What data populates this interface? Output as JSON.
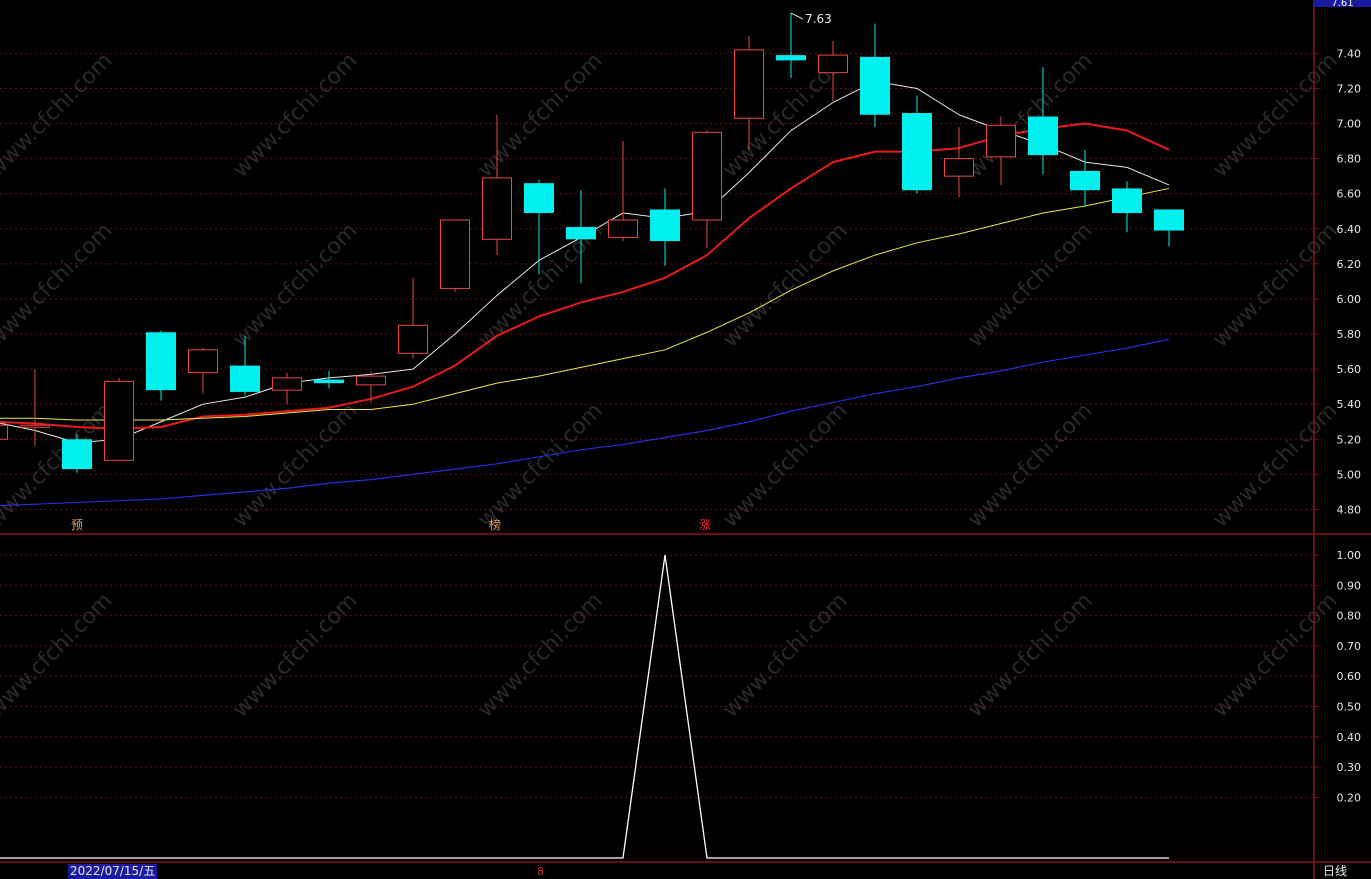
{
  "chart_data": {
    "type": "candlestick",
    "candles": [
      {
        "o": 5.2,
        "c": 5.28,
        "h": 5.34,
        "l": 5.14
      },
      {
        "o": 5.27,
        "c": 5.28,
        "h": 5.6,
        "l": 5.16
      },
      {
        "o": 5.2,
        "c": 5.03,
        "h": 5.23,
        "l": 5.01
      },
      {
        "o": 5.08,
        "c": 5.53,
        "h": 5.55,
        "l": 5.08
      },
      {
        "o": 5.81,
        "c": 5.48,
        "h": 5.82,
        "l": 5.42
      },
      {
        "o": 5.58,
        "c": 5.71,
        "h": 5.72,
        "l": 5.46
      },
      {
        "o": 5.62,
        "c": 5.47,
        "h": 5.79,
        "l": 5.45
      },
      {
        "o": 5.48,
        "c": 5.55,
        "h": 5.58,
        "l": 5.4
      },
      {
        "o": 5.54,
        "c": 5.52,
        "h": 5.59,
        "l": 5.49
      },
      {
        "o": 5.51,
        "c": 5.56,
        "h": 5.59,
        "l": 5.41
      },
      {
        "o": 5.69,
        "c": 5.85,
        "h": 6.12,
        "l": 5.66
      },
      {
        "o": 6.06,
        "c": 6.45,
        "h": 6.45,
        "l": 6.04
      },
      {
        "o": 6.34,
        "c": 6.69,
        "h": 7.05,
        "l": 6.25
      },
      {
        "o": 6.66,
        "c": 6.49,
        "h": 6.68,
        "l": 6.14
      },
      {
        "o": 6.41,
        "c": 6.34,
        "h": 6.62,
        "l": 6.09
      },
      {
        "o": 6.35,
        "c": 6.45,
        "h": 6.9,
        "l": 6.33
      },
      {
        "o": 6.51,
        "c": 6.33,
        "h": 6.63,
        "l": 6.19
      },
      {
        "o": 6.45,
        "c": 6.95,
        "h": 6.96,
        "l": 6.29
      },
      {
        "o": 7.03,
        "c": 7.42,
        "h": 7.5,
        "l": 6.85
      },
      {
        "o": 7.39,
        "c": 7.36,
        "h": 7.63,
        "l": 7.26
      },
      {
        "o": 7.29,
        "c": 7.39,
        "h": 7.47,
        "l": 7.13
      },
      {
        "o": 7.38,
        "c": 7.05,
        "h": 7.57,
        "l": 6.98
      },
      {
        "o": 7.06,
        "c": 6.62,
        "h": 7.16,
        "l": 6.6
      },
      {
        "o": 6.7,
        "c": 6.8,
        "h": 6.98,
        "l": 6.58
      },
      {
        "o": 6.81,
        "c": 6.99,
        "h": 7.04,
        "l": 6.65
      },
      {
        "o": 7.04,
        "c": 6.82,
        "h": 7.32,
        "l": 6.71
      },
      {
        "o": 6.73,
        "c": 6.62,
        "h": 6.85,
        "l": 6.53
      },
      {
        "o": 6.63,
        "c": 6.49,
        "h": 6.67,
        "l": 6.38
      },
      {
        "o": 6.51,
        "c": 6.39,
        "h": 6.51,
        "l": 6.3
      }
    ],
    "ma_lines": [
      {
        "color": "#e8e8e8",
        "width": 1,
        "values": [
          5.3,
          5.25,
          5.18,
          5.2,
          5.3,
          5.4,
          5.44,
          5.52,
          5.55,
          5.57,
          5.6,
          5.8,
          6.02,
          6.22,
          6.35,
          6.49,
          6.46,
          6.5,
          6.72,
          6.96,
          7.12,
          7.24,
          7.2,
          7.05,
          6.96,
          6.88,
          6.78,
          6.75,
          6.65
        ]
      },
      {
        "color": "#e81a1a",
        "width": 2,
        "values": [
          5.3,
          5.29,
          5.27,
          5.26,
          5.27,
          5.33,
          5.34,
          5.36,
          5.38,
          5.43,
          5.5,
          5.62,
          5.79,
          5.9,
          5.98,
          6.04,
          6.12,
          6.25,
          6.46,
          6.63,
          6.78,
          6.84,
          6.84,
          6.86,
          6.93,
          6.97,
          7.0,
          6.96,
          6.85
        ]
      },
      {
        "color": "#e8e84a",
        "width": 1,
        "values": [
          5.32,
          5.32,
          5.31,
          5.31,
          5.31,
          5.32,
          5.33,
          5.35,
          5.37,
          5.37,
          5.4,
          5.46,
          5.52,
          5.56,
          5.61,
          5.66,
          5.71,
          5.81,
          5.92,
          6.05,
          6.16,
          6.25,
          6.32,
          6.37,
          6.43,
          6.49,
          6.53,
          6.58,
          6.63
        ]
      },
      {
        "color": "#2b2bdc",
        "width": 1.2,
        "values": [
          4.82,
          4.83,
          4.84,
          4.85,
          4.86,
          4.88,
          4.9,
          4.92,
          4.95,
          4.97,
          5.0,
          5.03,
          5.06,
          5.1,
          5.14,
          5.17,
          5.21,
          5.25,
          5.3,
          5.36,
          5.41,
          5.46,
          5.5,
          5.55,
          5.59,
          5.64,
          5.68,
          5.72,
          5.77
        ]
      }
    ],
    "y_ticks": [
      "7.40",
      "7.20",
      "7.00",
      "6.80",
      "6.60",
      "6.40",
      "6.20",
      "6.00",
      "5.80",
      "5.60",
      "5.40",
      "5.20",
      "5.00",
      "4.80"
    ],
    "y_ticks_values": [
      7.4,
      7.2,
      7.0,
      6.8,
      6.6,
      6.4,
      6.2,
      6.0,
      5.8,
      5.6,
      5.4,
      5.2,
      5.0,
      4.8
    ],
    "ylim": [
      4.66,
      7.67
    ],
    "high_marker": {
      "index": 19,
      "label": "7.63"
    },
    "indicator": {
      "values": [
        0,
        0,
        0,
        0,
        0,
        0,
        0,
        0,
        0,
        0,
        0,
        0,
        0,
        0,
        0,
        0,
        1,
        0,
        0,
        0,
        0,
        0,
        0,
        0,
        0,
        0,
        0,
        0,
        0
      ],
      "y_ticks": [
        "1.00",
        "0.90",
        "0.80",
        "0.70",
        "0.60",
        "0.50",
        "0.40",
        "0.30",
        "0.20"
      ],
      "y_ticks_values": [
        1.0,
        0.9,
        0.8,
        0.7,
        0.6,
        0.5,
        0.4,
        0.3,
        0.2
      ]
    }
  },
  "markers": [
    {
      "label": "预",
      "color": "#e8a060"
    },
    {
      "label": "榜",
      "color": "#e8a060"
    },
    {
      "label": "涨",
      "color": "#e83030"
    }
  ],
  "top_badge": "7.61",
  "watermark": "www.cfchi.com",
  "footer": {
    "date": "2022/07/15/五",
    "mark": "8",
    "period": "日线"
  },
  "colors": {
    "up": "#e84646",
    "down": "#00f0f0",
    "frame": "#8c1212",
    "grid": "#5a1414",
    "axis_text": "#e8e8e8"
  }
}
